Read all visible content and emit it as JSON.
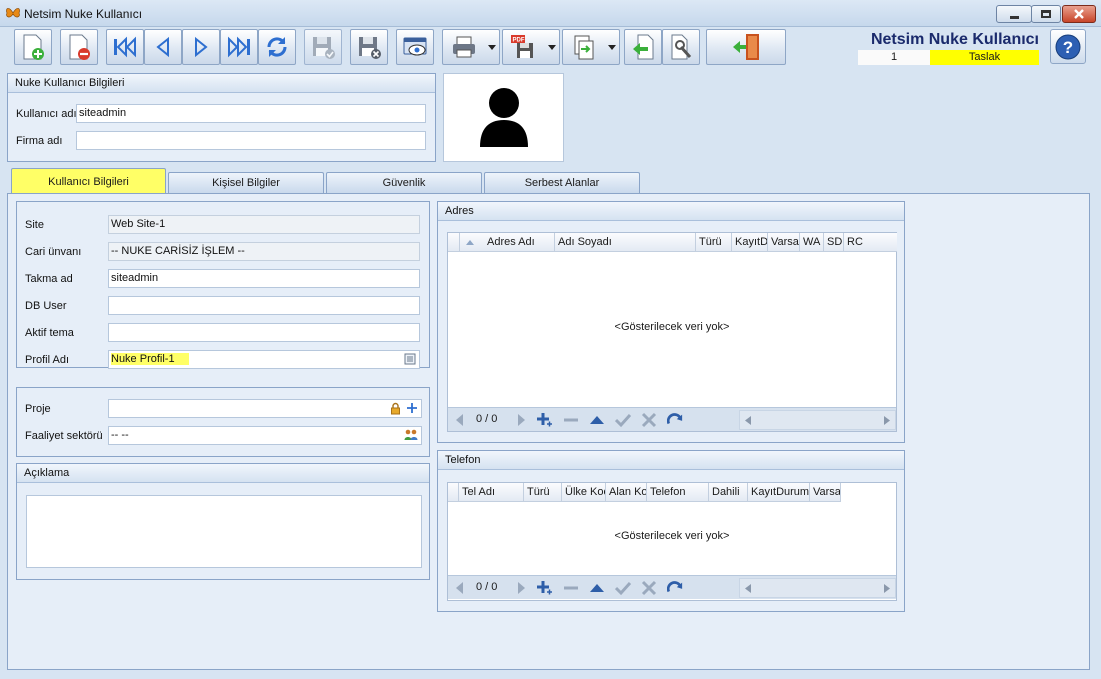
{
  "window": {
    "title": "Netsim Nuke Kullanıcı",
    "minimize_icon": "minimize-icon",
    "maximize_icon": "maximize-icon",
    "close_icon": "close-icon"
  },
  "toolbar": {
    "buttons": [
      "new-record",
      "delete-record",
      "first",
      "previous",
      "next",
      "last",
      "refresh",
      "save",
      "save-and-close",
      "preview",
      "print",
      "export-pdf",
      "export",
      "back",
      "settings",
      "exit"
    ]
  },
  "header": {
    "title": "Netsim Nuke Kullanıcı",
    "record_no": "1",
    "status": "Taslak",
    "status_color": "#ffff00"
  },
  "user_info": {
    "group_title": "Nuke Kullanıcı Bilgileri",
    "username_label": "Kullanıcı adı",
    "username_value": "siteadmin",
    "company_label": "Firma adı",
    "company_value": ""
  },
  "avatar": {
    "icon": "user-silhouette-icon"
  },
  "tabs": [
    {
      "label": "Kullanıcı Bilgileri",
      "active": true
    },
    {
      "label": "Kişisel Bilgiler",
      "active": false
    },
    {
      "label": "Güvenlik",
      "active": false
    },
    {
      "label": "Serbest Alanlar",
      "active": false
    }
  ],
  "details": {
    "site_label": "Site",
    "site_value": "Web Site-1",
    "cari_label": "Cari ünvanı",
    "cari_value": "-- NUKE CARİSİZ İŞLEM --",
    "takma_label": "Takma ad",
    "takma_value": "siteadmin",
    "dbuser_label": "DB User",
    "dbuser_value": "",
    "tema_label": "Aktif tema",
    "tema_value": "",
    "profil_label": "Profil Adı",
    "profil_value": "Nuke Profil-1"
  },
  "project": {
    "proje_label": "Proje",
    "proje_value": "",
    "sektor_label": "Faaliyet sektörü",
    "sektor_value": "-- --"
  },
  "aciklama": {
    "title": "Açıklama",
    "value": ""
  },
  "adres": {
    "title": "Adres",
    "columns": [
      "",
      "Adres Adı",
      "Adı Soyadı",
      "Türü",
      "KayıtD",
      "Varsa",
      "WA",
      "SD",
      "RC"
    ],
    "empty_text": "<Gösterilecek veri yok>",
    "nav_count": "0 / 0"
  },
  "telefon": {
    "title": "Telefon",
    "columns": [
      "",
      "Tel Adı",
      "Türü",
      "Ülke Koc",
      "Alan Ko",
      "Telefon",
      "Dahili",
      "KayıtDurumı",
      "Varsa"
    ],
    "empty_text": "<Gösterilecek veri yok>",
    "nav_count": "0 / 0"
  }
}
